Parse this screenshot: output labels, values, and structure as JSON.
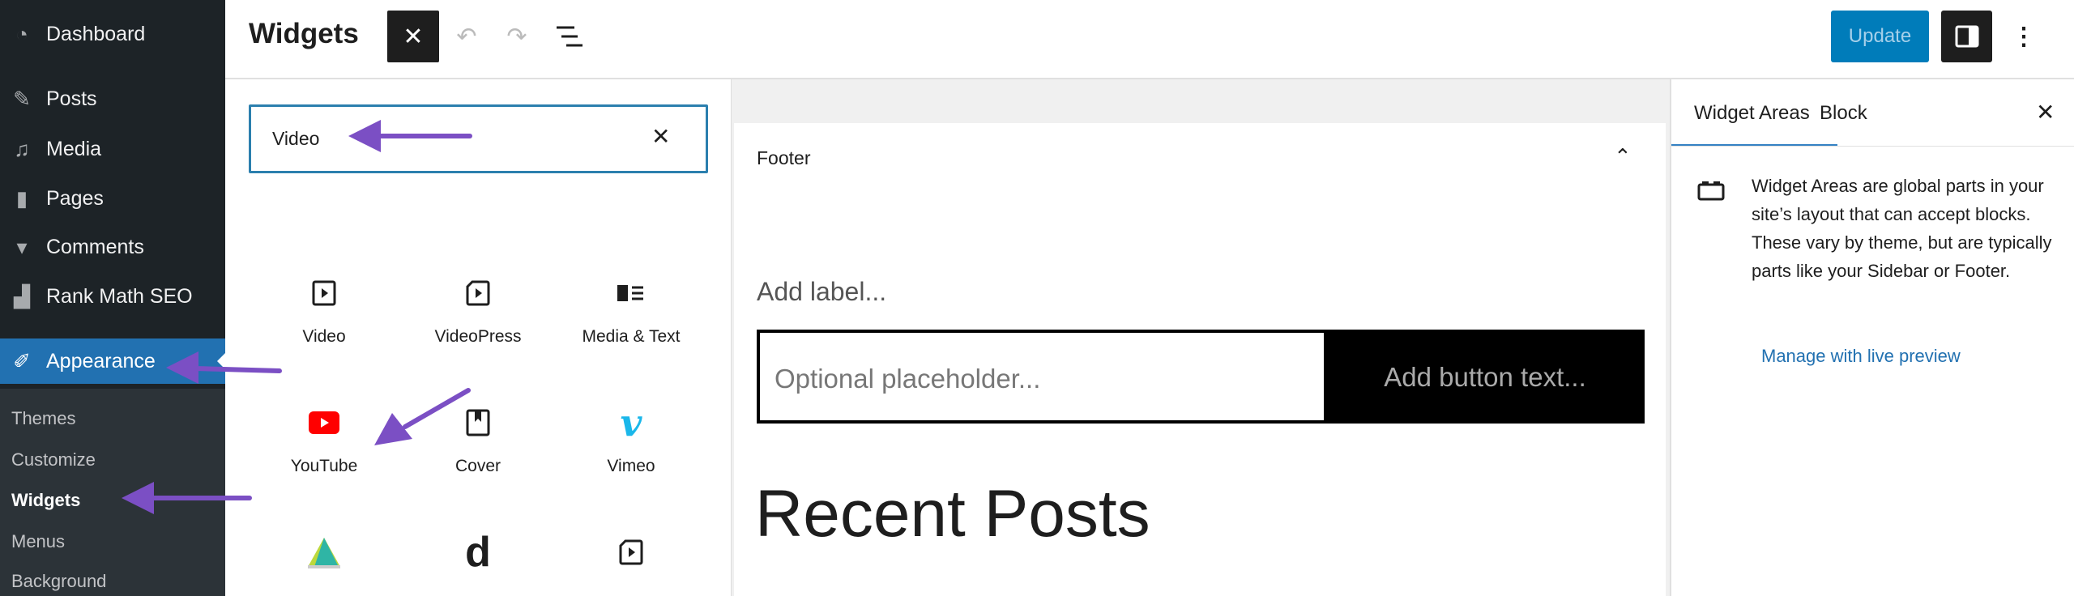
{
  "sidebar": {
    "items": [
      {
        "label": "Dashboard",
        "icon": "dashboard-icon"
      },
      {
        "label": "Posts",
        "icon": "pin-icon"
      },
      {
        "label": "Media",
        "icon": "media-icon"
      },
      {
        "label": "Pages",
        "icon": "pages-icon"
      },
      {
        "label": "Comments",
        "icon": "comment-icon"
      },
      {
        "label": "Rank Math SEO",
        "icon": "rank-math-icon"
      },
      {
        "label": "Appearance",
        "icon": "brush-icon",
        "active": true
      }
    ],
    "submenu": [
      {
        "label": "Themes"
      },
      {
        "label": "Customize"
      },
      {
        "label": "Widgets",
        "current": true
      },
      {
        "label": "Menus"
      },
      {
        "label": "Background"
      }
    ]
  },
  "header": {
    "title": "Widgets",
    "update_label": "Update"
  },
  "inserter": {
    "search_value": "Video",
    "blocks": [
      {
        "label": "Video"
      },
      {
        "label": "VideoPress"
      },
      {
        "label": "Media & Text"
      },
      {
        "label": "YouTube"
      },
      {
        "label": "Cover"
      },
      {
        "label": "Vimeo"
      },
      {
        "label": ""
      },
      {
        "label": ""
      },
      {
        "label": ""
      }
    ]
  },
  "editor": {
    "area_title": "Footer",
    "add_label": "Add label...",
    "input_placeholder": "Optional placeholder...",
    "button_placeholder": "Add button text...",
    "heading": "Recent Posts"
  },
  "panel": {
    "tabs": [
      {
        "label": "Widget Areas",
        "active": true
      },
      {
        "label": "Block"
      }
    ],
    "description": "Widget Areas are global parts in your site’s layout that can accept blocks. These vary by theme, but are typically parts like your Sidebar or Footer.",
    "link": "Manage with live preview"
  },
  "colors": {
    "accent": "#2271b1",
    "annotation": "#7b4fc4",
    "update": "#007cba"
  }
}
